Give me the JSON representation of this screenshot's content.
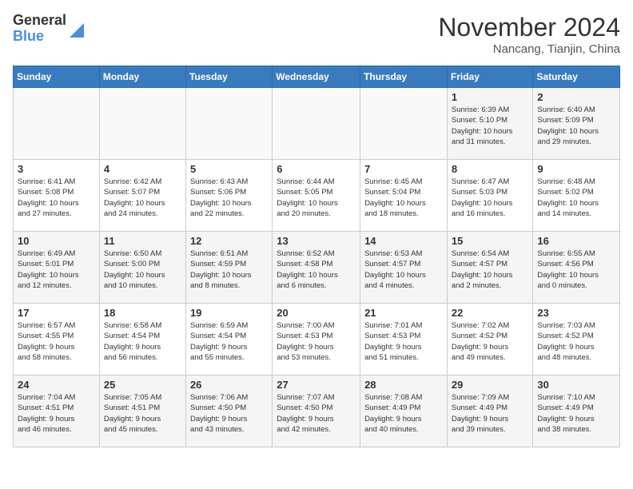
{
  "header": {
    "logo_general": "General",
    "logo_blue": "Blue",
    "month_title": "November 2024",
    "location": "Nancang, Tianjin, China"
  },
  "weekdays": [
    "Sunday",
    "Monday",
    "Tuesday",
    "Wednesday",
    "Thursday",
    "Friday",
    "Saturday"
  ],
  "weeks": [
    [
      {
        "day": "",
        "info": ""
      },
      {
        "day": "",
        "info": ""
      },
      {
        "day": "",
        "info": ""
      },
      {
        "day": "",
        "info": ""
      },
      {
        "day": "",
        "info": ""
      },
      {
        "day": "1",
        "info": "Sunrise: 6:39 AM\nSunset: 5:10 PM\nDaylight: 10 hours\nand 31 minutes."
      },
      {
        "day": "2",
        "info": "Sunrise: 6:40 AM\nSunset: 5:09 PM\nDaylight: 10 hours\nand 29 minutes."
      }
    ],
    [
      {
        "day": "3",
        "info": "Sunrise: 6:41 AM\nSunset: 5:08 PM\nDaylight: 10 hours\nand 27 minutes."
      },
      {
        "day": "4",
        "info": "Sunrise: 6:42 AM\nSunset: 5:07 PM\nDaylight: 10 hours\nand 24 minutes."
      },
      {
        "day": "5",
        "info": "Sunrise: 6:43 AM\nSunset: 5:06 PM\nDaylight: 10 hours\nand 22 minutes."
      },
      {
        "day": "6",
        "info": "Sunrise: 6:44 AM\nSunset: 5:05 PM\nDaylight: 10 hours\nand 20 minutes."
      },
      {
        "day": "7",
        "info": "Sunrise: 6:45 AM\nSunset: 5:04 PM\nDaylight: 10 hours\nand 18 minutes."
      },
      {
        "day": "8",
        "info": "Sunrise: 6:47 AM\nSunset: 5:03 PM\nDaylight: 10 hours\nand 16 minutes."
      },
      {
        "day": "9",
        "info": "Sunrise: 6:48 AM\nSunset: 5:02 PM\nDaylight: 10 hours\nand 14 minutes."
      }
    ],
    [
      {
        "day": "10",
        "info": "Sunrise: 6:49 AM\nSunset: 5:01 PM\nDaylight: 10 hours\nand 12 minutes."
      },
      {
        "day": "11",
        "info": "Sunrise: 6:50 AM\nSunset: 5:00 PM\nDaylight: 10 hours\nand 10 minutes."
      },
      {
        "day": "12",
        "info": "Sunrise: 6:51 AM\nSunset: 4:59 PM\nDaylight: 10 hours\nand 8 minutes."
      },
      {
        "day": "13",
        "info": "Sunrise: 6:52 AM\nSunset: 4:58 PM\nDaylight: 10 hours\nand 6 minutes."
      },
      {
        "day": "14",
        "info": "Sunrise: 6:53 AM\nSunset: 4:57 PM\nDaylight: 10 hours\nand 4 minutes."
      },
      {
        "day": "15",
        "info": "Sunrise: 6:54 AM\nSunset: 4:57 PM\nDaylight: 10 hours\nand 2 minutes."
      },
      {
        "day": "16",
        "info": "Sunrise: 6:55 AM\nSunset: 4:56 PM\nDaylight: 10 hours\nand 0 minutes."
      }
    ],
    [
      {
        "day": "17",
        "info": "Sunrise: 6:57 AM\nSunset: 4:55 PM\nDaylight: 9 hours\nand 58 minutes."
      },
      {
        "day": "18",
        "info": "Sunrise: 6:58 AM\nSunset: 4:54 PM\nDaylight: 9 hours\nand 56 minutes."
      },
      {
        "day": "19",
        "info": "Sunrise: 6:59 AM\nSunset: 4:54 PM\nDaylight: 9 hours\nand 55 minutes."
      },
      {
        "day": "20",
        "info": "Sunrise: 7:00 AM\nSunset: 4:53 PM\nDaylight: 9 hours\nand 53 minutes."
      },
      {
        "day": "21",
        "info": "Sunrise: 7:01 AM\nSunset: 4:53 PM\nDaylight: 9 hours\nand 51 minutes."
      },
      {
        "day": "22",
        "info": "Sunrise: 7:02 AM\nSunset: 4:52 PM\nDaylight: 9 hours\nand 49 minutes."
      },
      {
        "day": "23",
        "info": "Sunrise: 7:03 AM\nSunset: 4:52 PM\nDaylight: 9 hours\nand 48 minutes."
      }
    ],
    [
      {
        "day": "24",
        "info": "Sunrise: 7:04 AM\nSunset: 4:51 PM\nDaylight: 9 hours\nand 46 minutes."
      },
      {
        "day": "25",
        "info": "Sunrise: 7:05 AM\nSunset: 4:51 PM\nDaylight: 9 hours\nand 45 minutes."
      },
      {
        "day": "26",
        "info": "Sunrise: 7:06 AM\nSunset: 4:50 PM\nDaylight: 9 hours\nand 43 minutes."
      },
      {
        "day": "27",
        "info": "Sunrise: 7:07 AM\nSunset: 4:50 PM\nDaylight: 9 hours\nand 42 minutes."
      },
      {
        "day": "28",
        "info": "Sunrise: 7:08 AM\nSunset: 4:49 PM\nDaylight: 9 hours\nand 40 minutes."
      },
      {
        "day": "29",
        "info": "Sunrise: 7:09 AM\nSunset: 4:49 PM\nDaylight: 9 hours\nand 39 minutes."
      },
      {
        "day": "30",
        "info": "Sunrise: 7:10 AM\nSunset: 4:49 PM\nDaylight: 9 hours\nand 38 minutes."
      }
    ]
  ]
}
